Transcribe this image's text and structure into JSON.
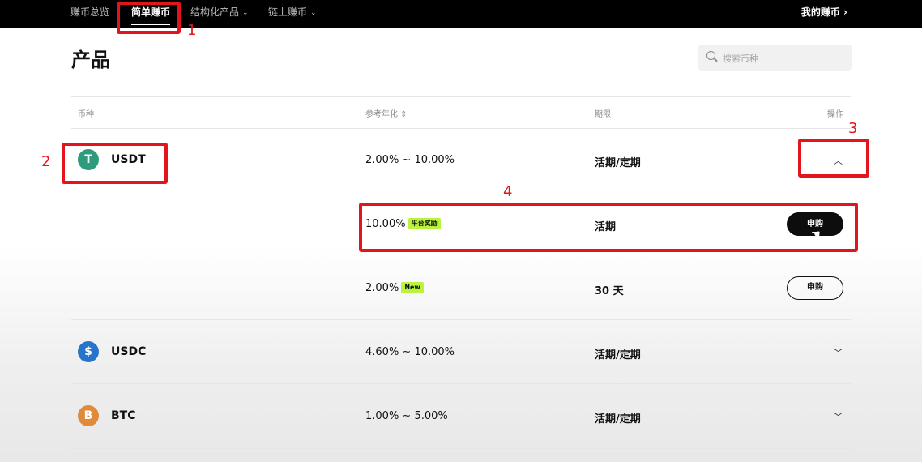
{
  "nav": {
    "items": [
      {
        "label": "赚币总览"
      },
      {
        "label": "简单赚币"
      },
      {
        "label": "结构化产品"
      },
      {
        "label": "链上赚币"
      }
    ],
    "right": "我的赚币 ›"
  },
  "page": {
    "title": "产品",
    "search_placeholder": "搜索币种"
  },
  "table": {
    "headers": {
      "coin": "币种",
      "rate": "参考年化 ⇕",
      "period": "期限",
      "action": "操作"
    },
    "rows": [
      {
        "coin": "USDT",
        "icon": "T",
        "color": "#2e9b7d",
        "rate": "2.00% ~ 10.00%",
        "period": "活期/定期",
        "products": [
          {
            "rate": "10.00%",
            "tag": "平台奖励",
            "period": "活期",
            "button": "申购"
          },
          {
            "rate": "2.00%",
            "tag": "New",
            "period": "30 天",
            "button": "申购"
          }
        ]
      },
      {
        "coin": "USDC",
        "icon": "$",
        "color": "#2775ca",
        "rate": "4.60% ~ 10.00%",
        "period": "活期/定期"
      },
      {
        "coin": "BTC",
        "icon": "B",
        "color": "#e08a3c",
        "rate": "1.00% ~ 5.00%",
        "period": "活期/定期"
      }
    ]
  },
  "annotations": [
    "1",
    "2",
    "3",
    "4"
  ],
  "colors": {
    "annotation": "#e3141c",
    "tag": "#b9f33d",
    "nav_bg": "#000000"
  }
}
